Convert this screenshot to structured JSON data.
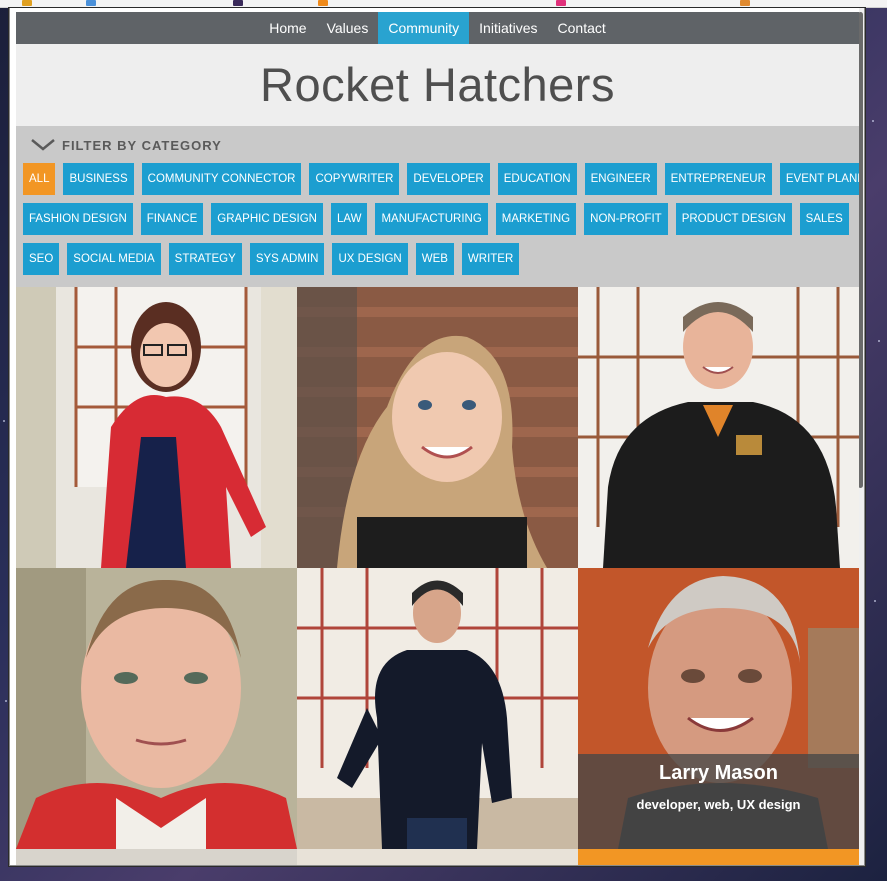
{
  "nav": {
    "items": [
      {
        "label": "Home"
      },
      {
        "label": "Values"
      },
      {
        "label": "Community",
        "active": true
      },
      {
        "label": "Initiatives"
      },
      {
        "label": "Contact"
      }
    ]
  },
  "header": {
    "title": "Rocket Hatchers"
  },
  "filter": {
    "title": "FILTER BY CATEGORY",
    "rows": [
      [
        "ALL",
        "BUSINESS",
        "COMMUNITY CONNECTOR",
        "COPYWRITER",
        "DEVELOPER",
        "EDUCATION",
        "ENGINEER",
        "ENTREPRENEUR",
        "EVENT PLANNER"
      ],
      [
        "FASHION DESIGN",
        "FINANCE",
        "GRAPHIC DESIGN",
        "LAW",
        "MANUFACTURING",
        "MARKETING",
        "NON-PROFIT",
        "PRODUCT DESIGN",
        "SALES"
      ],
      [
        "SEO",
        "SOCIAL MEDIA",
        "STRATEGY",
        "SYS ADMIN",
        "UX DESIGN",
        "WEB",
        "WRITER"
      ]
    ],
    "active": "ALL"
  },
  "members": {
    "featured": {
      "name": "Larry Mason",
      "roles": "developer, web, UX design"
    }
  },
  "colors": {
    "nav_bg": "#5f6367",
    "nav_active": "#29a3d0",
    "tag_bg": "#1c9ed0",
    "tag_active": "#f29624",
    "filter_bg": "#c9c9c9"
  }
}
